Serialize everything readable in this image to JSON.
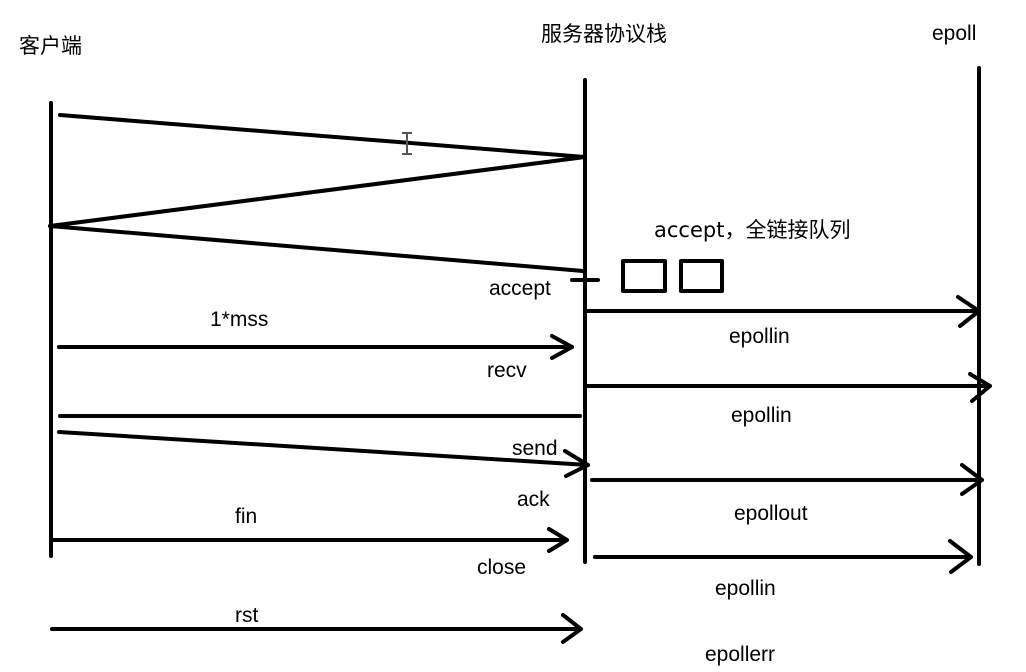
{
  "lifelines": {
    "client": "客户端",
    "server": "服务器协议栈",
    "epoll": "epoll"
  },
  "labels": {
    "queue_note": "accept，全链接队列",
    "accept": "accept",
    "mss": "1*mss",
    "recv": "recv",
    "send": "send",
    "ack": "ack",
    "fin": "fin",
    "close": "close",
    "rst": "rst",
    "epollin_1": "epollin",
    "epollin_2": "epollin",
    "epollout": "epollout",
    "epollin_3": "epollin",
    "epollerr": "epollerr"
  },
  "colors": {
    "ink": "#000000",
    "background": "#ffffff"
  }
}
